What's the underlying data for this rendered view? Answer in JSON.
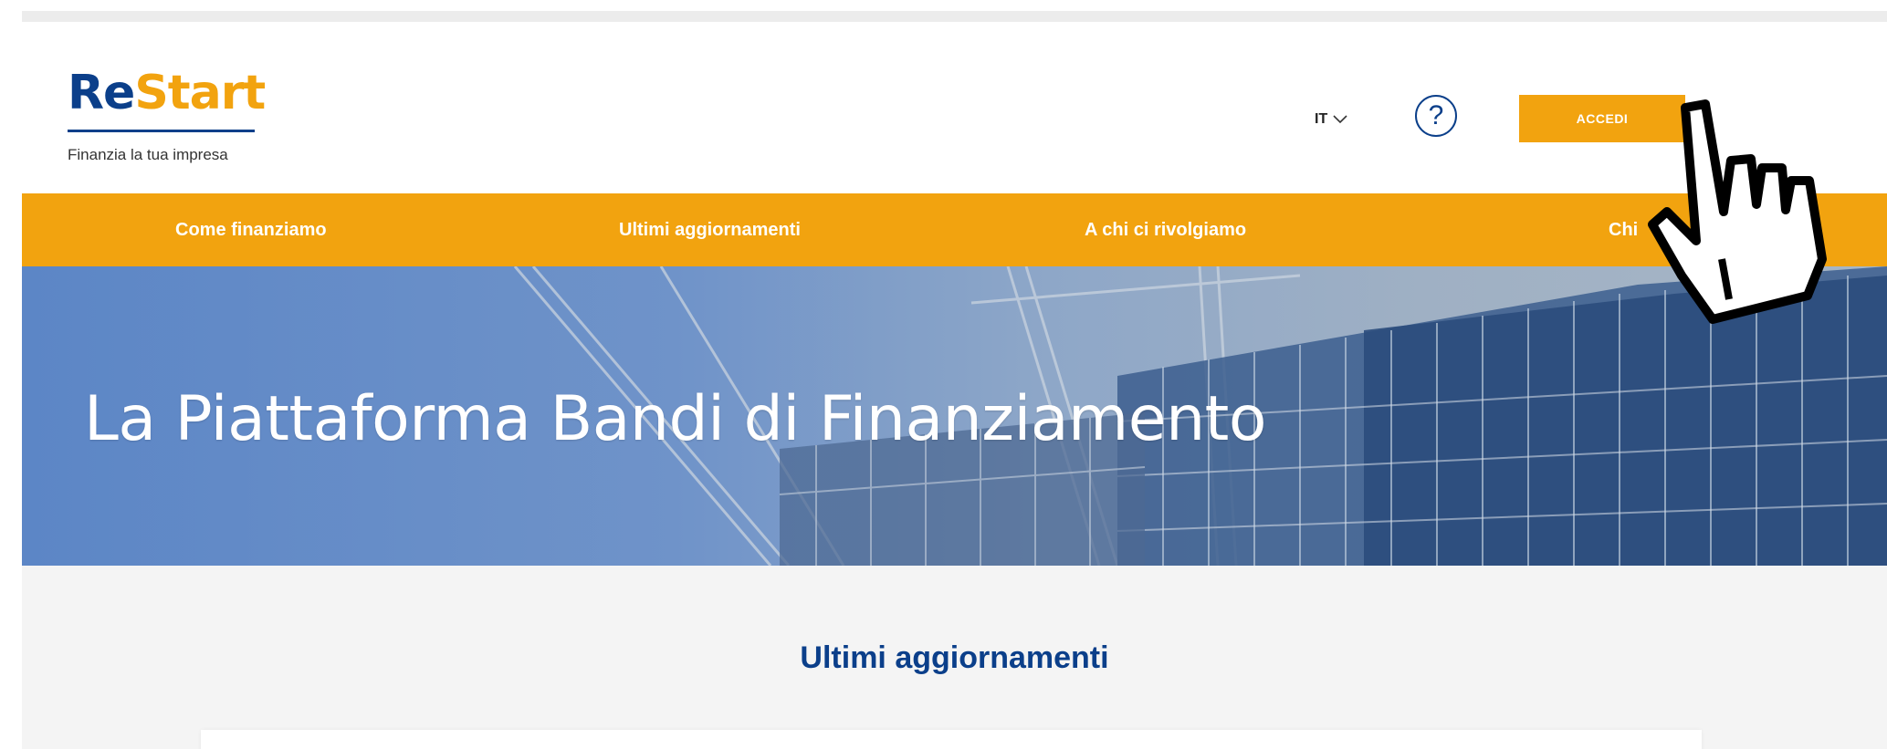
{
  "brand": {
    "logo_part1": "Re",
    "logo_part2": "Start",
    "tagline": "Finanzia la tua impresa"
  },
  "header": {
    "language": "IT",
    "help_symbol": "?",
    "login_label": "ACCEDI"
  },
  "nav": {
    "items": [
      {
        "label": "Come finanziamo"
      },
      {
        "label": "Ultimi aggiornamenti"
      },
      {
        "label": "A chi ci rivolgiamo"
      },
      {
        "label": "Chi"
      }
    ]
  },
  "hero": {
    "title": "La Piattaforma Bandi di Finanziamento"
  },
  "section": {
    "title": "Ultimi aggiornamenti"
  },
  "colors": {
    "brand_blue": "#0b3f8a",
    "brand_orange": "#f2a30f"
  },
  "icons": [
    "chevron-down-icon",
    "help-icon",
    "hand-pointer-cursor-icon"
  ]
}
